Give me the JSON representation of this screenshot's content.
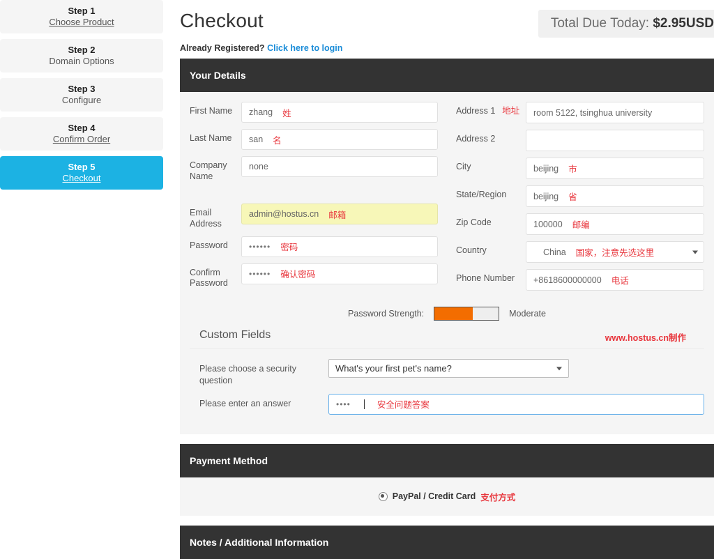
{
  "sidebar": {
    "steps": [
      {
        "step": "Step 1",
        "name": "Choose Product",
        "underline": true,
        "active": false
      },
      {
        "step": "Step 2",
        "name": "Domain Options",
        "underline": false,
        "active": false
      },
      {
        "step": "Step 3",
        "name": "Configure",
        "underline": false,
        "active": false
      },
      {
        "step": "Step 4",
        "name": "Confirm Order",
        "underline": true,
        "active": false
      },
      {
        "step": "Step 5",
        "name": "Checkout",
        "underline": true,
        "active": true
      }
    ],
    "active_color": "#1cb2e3"
  },
  "header": {
    "title": "Checkout",
    "total_label": "Total Due Today:",
    "total_value": "$2.95USD",
    "registered_text": "Already Registered?",
    "login_link": "Click here to login",
    "link_color": "#1a8cd8"
  },
  "your_details": {
    "heading": "Your Details",
    "left_fields": [
      {
        "label": "First Name",
        "value": "zhang",
        "cn": "姓",
        "autofill": false
      },
      {
        "label": "Last Name",
        "value": "san",
        "cn": "名",
        "autofill": false
      },
      {
        "label": "Company Name",
        "value": "none",
        "cn": "",
        "autofill": false
      }
    ],
    "account_fields": [
      {
        "label": "Email Address",
        "value": "admin@hostus.cn",
        "cn": "邮箱",
        "autofill": true
      },
      {
        "label": "Password",
        "value": "••••••",
        "cn": "密码",
        "autofill": false
      },
      {
        "label": "Confirm Password",
        "value": "••••••",
        "cn": "确认密码",
        "autofill": false
      }
    ],
    "right_fields": [
      {
        "label": "Address 1",
        "label_cn": "地址",
        "value": "room 5122, tsinghua university",
        "cn": "",
        "select": false
      },
      {
        "label": "Address 2",
        "label_cn": "",
        "value": "",
        "cn": "",
        "select": false
      },
      {
        "label": "City",
        "label_cn": "",
        "value": "beijing",
        "cn": "市",
        "select": false
      },
      {
        "label": "State/Region",
        "label_cn": "",
        "value": "beijing",
        "cn": "省",
        "select": false
      },
      {
        "label": "Zip Code",
        "label_cn": "",
        "value": "100000",
        "cn": "邮编",
        "select": false
      },
      {
        "label": "Country",
        "label_cn": "",
        "value": "China",
        "cn": "国家，注意先选这里",
        "select": true
      },
      {
        "label": "Phone Number",
        "label_cn": "",
        "value": "+8618600000000",
        "cn": "电话",
        "select": false
      }
    ],
    "password_strength": {
      "label": "Password Strength:",
      "level": "Moderate",
      "percent": 60,
      "bar_color": "#f36d00"
    }
  },
  "custom_fields": {
    "heading": "Custom Fields",
    "watermark": "www.hostus.cn制作",
    "watermark_color": "#e8353c",
    "question_label": "Please choose a security question",
    "question_value": "What's your first pet's name?",
    "answer_label": "Please enter an answer",
    "answer_value": "••••",
    "answer_cn": "安全问题答案"
  },
  "payment": {
    "heading": "Payment Method",
    "option_label": "PayPal / Credit Card",
    "option_cn": "支付方式",
    "selected": true
  },
  "notes": {
    "heading": "Notes / Additional Information"
  }
}
